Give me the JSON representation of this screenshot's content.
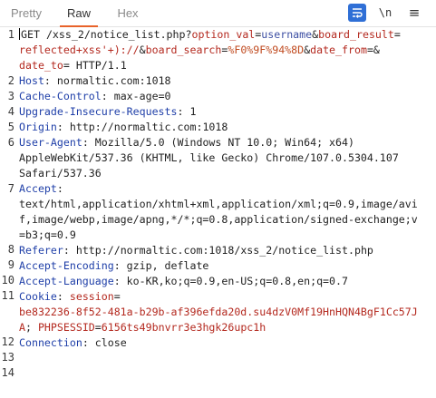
{
  "tabs": {
    "pretty": "Pretty",
    "raw": "Raw",
    "hex": "Hex"
  },
  "toolbar": {
    "newline_label": "\\n",
    "menu_label": "≡"
  },
  "lines": [
    {
      "num": "1"
    },
    {
      "num": "2"
    },
    {
      "num": "3"
    },
    {
      "num": "4"
    },
    {
      "num": "5"
    },
    {
      "num": "6"
    },
    {
      "num": "7"
    },
    {
      "num": "8"
    },
    {
      "num": "9"
    },
    {
      "num": "10"
    },
    {
      "num": "11"
    },
    {
      "num": "12"
    },
    {
      "num": "13"
    },
    {
      "num": "14"
    }
  ],
  "request": {
    "method": "GET",
    "path": "/xss_2/notice_list.php?",
    "p1_name": "option_val",
    "p1_val": "username",
    "p2_name": "board_result",
    "p2_val_a": "reflected+xss'+)://",
    "p3_name": "board_search",
    "p3_val": "%F0%9F%94%8D",
    "p4_name": "date_from",
    "p5_name": "date_to",
    "protocol": "HTTP/1.1",
    "eq": "=",
    "amp": "&"
  },
  "headers": {
    "host_name": "Host",
    "host_val": "normaltic.com:1018",
    "cache_name": "Cache-Control",
    "cache_val": "max-age=0",
    "uir_name": "Upgrade-Insecure-Requests",
    "uir_val": "1",
    "origin_name": "Origin",
    "origin_val": "http://normaltic.com:1018",
    "ua_name": "User-Agent",
    "ua_val_1": "Mozilla/5.0 (Windows NT 10.0; Win64; x64)",
    "ua_val_2": "AppleWebKit/537.36 (KHTML, like Gecko) Chrome/107.0.5304.107",
    "ua_val_3": "Safari/537.36",
    "accept_name": "Accept",
    "accept_val_1": "text/html,application/xhtml+xml,application/xml;q=0.9,image/avi",
    "accept_val_2": "f,image/webp,image/apng,*/*;q=0.8,application/signed-exchange;v",
    "accept_val_3": "=b3;q=0.9",
    "referer_name": "Referer",
    "referer_val": "http://normaltic.com:1018/xss_2/notice_list.php",
    "ae_name": "Accept-Encoding",
    "ae_val": "gzip, deflate",
    "al_name": "Accept-Language",
    "al_val": "ko-KR,ko;q=0.9,en-US;q=0.8,en;q=0.7",
    "cookie_name": "Cookie",
    "cookie_k1": "session",
    "cookie_v1_a": "be832236-8f52-481a-b29b-af396efda20d.su4dzV0Mf19HnHQN4BgF1Cc57J",
    "cookie_v1_b": "A",
    "cookie_k2": "PHPSESSID",
    "cookie_v2": "6156ts49bnvrr3e3hgk26upc1h",
    "conn_name": "Connection",
    "conn_val": "close"
  }
}
